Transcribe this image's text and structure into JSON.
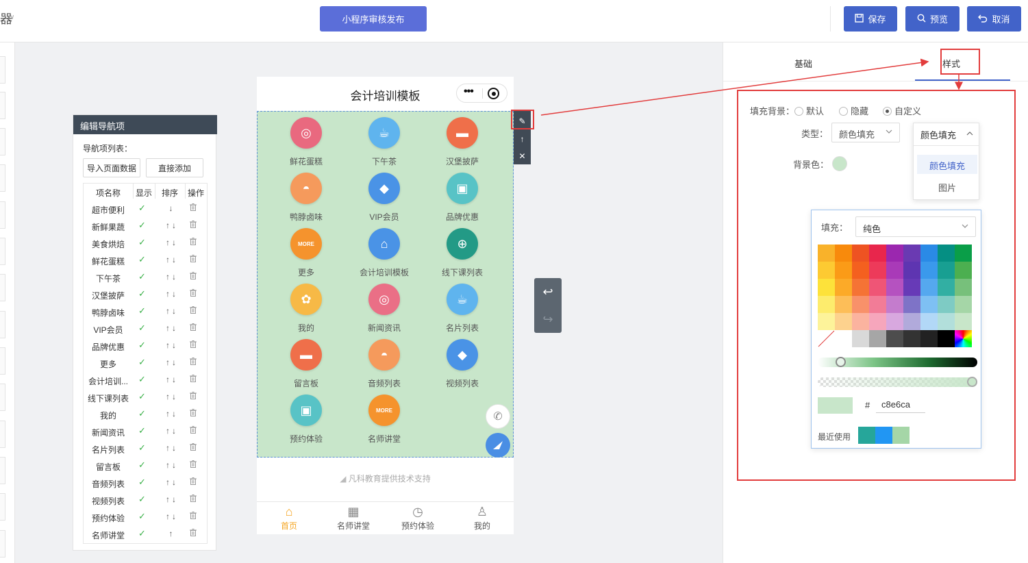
{
  "topbar": {
    "logo_fragment": "器",
    "publish_label": "小程序审核发布",
    "save_label": "保存",
    "preview_label": "预览",
    "cancel_label": "取消"
  },
  "nav_editor": {
    "title": "编辑导航项",
    "list_label": "导航项列表：",
    "import_btn": "导入页面数据",
    "add_btn": "直接添加",
    "headers": [
      "项名称",
      "显示",
      "排序",
      "操作"
    ],
    "rows": [
      {
        "name": "超市便利",
        "sort": "↓"
      },
      {
        "name": "新鲜果蔬",
        "sort": "↑↓"
      },
      {
        "name": "美食烘焙",
        "sort": "↑↓"
      },
      {
        "name": "鲜花蛋糕",
        "sort": "↑↓"
      },
      {
        "name": "下午茶",
        "sort": "↑↓"
      },
      {
        "name": "汉堡披萨",
        "sort": "↑↓"
      },
      {
        "name": "鸭脖卤味",
        "sort": "↑↓"
      },
      {
        "name": "VIP会员",
        "sort": "↑↓"
      },
      {
        "name": "品牌优惠",
        "sort": "↑↓"
      },
      {
        "name": "更多",
        "sort": "↑↓"
      },
      {
        "name": "会计培训...",
        "sort": "↑↓"
      },
      {
        "name": "线下课列表",
        "sort": "↑↓"
      },
      {
        "name": "我的",
        "sort": "↑↓"
      },
      {
        "name": "新闻资讯",
        "sort": "↑↓"
      },
      {
        "name": "名片列表",
        "sort": "↑↓"
      },
      {
        "name": "留言板",
        "sort": "↑↓"
      },
      {
        "name": "音频列表",
        "sort": "↑↓"
      },
      {
        "name": "视频列表",
        "sort": "↑↓"
      },
      {
        "name": "预约体验",
        "sort": "↑↓"
      },
      {
        "name": "名师讲堂",
        "sort": "↑"
      }
    ]
  },
  "phone": {
    "title": "会计培训模板",
    "grid": [
      {
        "label": "鲜花蛋糕",
        "icon": "cake-icon",
        "color": "#e9697f"
      },
      {
        "label": "下午茶",
        "icon": "coffee-icon",
        "color": "#5fb4ee"
      },
      {
        "label": "汉堡披萨",
        "icon": "burger-icon",
        "color": "#ef6f4a"
      },
      {
        "label": "鸭脖卤味",
        "icon": "cloche-icon",
        "color": "#f59a5c"
      },
      {
        "label": "VIP会员",
        "icon": "diamond-icon",
        "color": "#4a93e6"
      },
      {
        "label": "品牌优惠",
        "icon": "gift-icon",
        "color": "#58c3c6"
      },
      {
        "label": "更多",
        "icon": "more-icon",
        "color": "#f5932d"
      },
      {
        "label": "会计培训模板",
        "icon": "store-icon",
        "color": "#4a93e6"
      },
      {
        "label": "线下课列表",
        "icon": "globe-icon",
        "color": "#239a86"
      },
      {
        "label": "我的",
        "icon": "popcorn-icon",
        "color": "#f7b946"
      },
      {
        "label": "新闻资讯",
        "icon": "donut-icon",
        "color": "#ea6f86"
      },
      {
        "label": "名片列表",
        "icon": "coffee-icon",
        "color": "#5fb4ee"
      },
      {
        "label": "留言板",
        "icon": "burger-icon",
        "color": "#ef6f4a"
      },
      {
        "label": "音频列表",
        "icon": "cloche-icon",
        "color": "#f59a5c"
      },
      {
        "label": "视频列表",
        "icon": "diamond-icon",
        "color": "#4a93e6"
      },
      {
        "label": "预约体验",
        "icon": "gift-icon",
        "color": "#58c3c6"
      },
      {
        "label": "名师讲堂",
        "icon": "more-icon",
        "color": "#f5932d"
      }
    ],
    "more_text": "MORE",
    "support_text": "凡科教育提供技术支持",
    "tabs": [
      {
        "label": "首页",
        "icon": "home-icon",
        "active": true
      },
      {
        "label": "名师讲堂",
        "icon": "grid-icon"
      },
      {
        "label": "预约体验",
        "icon": "clock-icon"
      },
      {
        "label": "我的",
        "icon": "user-icon"
      }
    ]
  },
  "right_panel": {
    "tab_basic": "基础",
    "tab_style": "样式",
    "fill_bg_label": "填充背景：",
    "radio_default": "默认",
    "radio_hidden": "隐藏",
    "radio_custom": "自定义",
    "type_label": "类型：",
    "type_value": "颜色填充",
    "dropdown_head": "颜色填充",
    "dropdown_options": [
      "颜色填充",
      "图片"
    ],
    "bg_color_label": "背景色：",
    "bg_color": "#c8e6ca",
    "picker": {
      "fill_label": "填充：",
      "fill_value": "纯色",
      "hash": "#",
      "hex": "c8e6ca",
      "recent_label": "最近使用",
      "recent_colors": [
        "#26a69a",
        "#2196f3",
        "#a5d6a7"
      ],
      "palette": [
        [
          "#f9b22a",
          "#f88a0c",
          "#ee5322",
          "#e8264c",
          "#9b27af",
          "#6a3ab2",
          "#2a8ae6",
          "#058f83",
          "#0a9e48"
        ],
        [
          "#fdca32",
          "#fb9b17",
          "#f4601f",
          "#ed3a5a",
          "#a93ab8",
          "#5e35b1",
          "#3a99ec",
          "#189f92",
          "#4caf50"
        ],
        [
          "#fde23a",
          "#fcaa28",
          "#f57335",
          "#ef5576",
          "#b552c0",
          "#673ab7",
          "#55a8ef",
          "#32afa3",
          "#77c07b"
        ],
        [
          "#fdec6d",
          "#fdbe58",
          "#f8916a",
          "#f27c97",
          "#c47ccd",
          "#7e73c7",
          "#7ec0f3",
          "#7ecbc4",
          "#a5d6a7"
        ],
        [
          "#fdf39a",
          "#fdd28e",
          "#fbb39f",
          "#f6a6bc",
          "#d8a8df",
          "#b1aadb",
          "#b2d8f7",
          "#b2dfdb",
          "#c8e6c9"
        ],
        [
          "none",
          "#ffffff",
          "#d9d9d9",
          "#a6a6a6",
          "#4d4d4d",
          "#333333",
          "#222222",
          "#000000",
          "spectrum"
        ]
      ]
    }
  }
}
